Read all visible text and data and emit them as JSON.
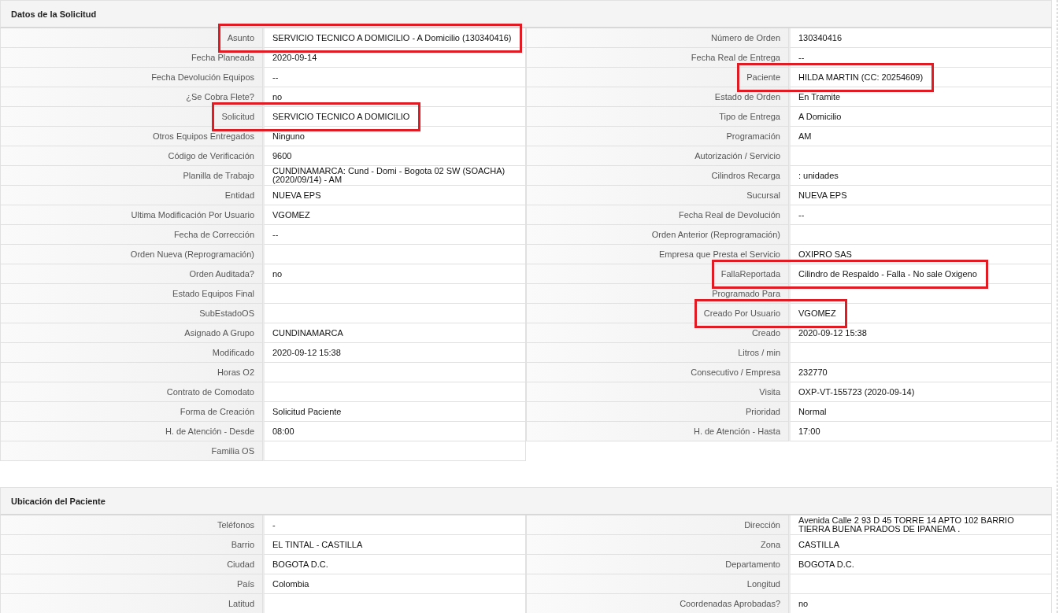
{
  "sections": [
    {
      "title": "Datos de la Solicitud",
      "left": [
        {
          "label": "Asunto",
          "value": "SERVICIO TECNICO A DOMICILIO - A Domicilio (130340416)",
          "highlighted": true
        },
        {
          "label": "Fecha Planeada",
          "value": "2020-09-14",
          "highlighted": false
        },
        {
          "label": "Fecha Devolución Equipos",
          "value": "--",
          "highlighted": false
        },
        {
          "label": "¿Se Cobra Flete?",
          "value": "no",
          "highlighted": false
        },
        {
          "label": "Solicitud",
          "value": "SERVICIO TECNICO A DOMICILIO",
          "highlighted": true
        },
        {
          "label": "Otros Equipos Entregados",
          "value": "Ninguno",
          "highlighted": false
        },
        {
          "label": "Código de Verificación",
          "value": "9600",
          "highlighted": false
        },
        {
          "label": "Planilla de Trabajo",
          "value": "CUNDINAMARCA: Cund - Domi - Bogota 02 SW (SOACHA) (2020/09/14) - AM",
          "highlighted": false
        },
        {
          "label": "Entidad",
          "value": "NUEVA EPS",
          "highlighted": false
        },
        {
          "label": "Ultima Modificación Por Usuario",
          "value": "VGOMEZ",
          "highlighted": false
        },
        {
          "label": "Fecha de Corrección",
          "value": "--",
          "highlighted": false
        },
        {
          "label": "Orden Nueva (Reprogramación)",
          "highlighted": false
        },
        {
          "label": "Orden Auditada?",
          "value": "no",
          "highlighted": false
        },
        {
          "label": "Estado Equipos Final",
          "highlighted": false
        },
        {
          "label": "SubEstadoOS",
          "highlighted": false
        },
        {
          "label": "Asignado A Grupo",
          "value": "CUNDINAMARCA",
          "highlighted": false
        },
        {
          "label": "Modificado",
          "value": "2020-09-12 15:38",
          "highlighted": false
        },
        {
          "label": "Horas O2",
          "highlighted": false
        },
        {
          "label": "Contrato de Comodato",
          "highlighted": false
        },
        {
          "label": "Forma de Creación",
          "value": "Solicitud Paciente",
          "highlighted": false
        },
        {
          "label": "H. de Atención - Desde",
          "value": "08:00",
          "highlighted": false
        },
        {
          "label": "Familia OS",
          "highlighted": false
        }
      ],
      "right": [
        {
          "label": "Número de Orden",
          "value": "130340416",
          "highlighted": false
        },
        {
          "label": "Fecha Real de Entrega",
          "value": "--",
          "highlighted": false
        },
        {
          "label": "Paciente",
          "value": "HILDA MARTIN (CC: 20254609)",
          "highlighted": true
        },
        {
          "label": "Estado de Orden",
          "value": "En Tramite",
          "highlighted": false
        },
        {
          "label": "Tipo de Entrega",
          "value": "A Domicilio",
          "highlighted": false
        },
        {
          "label": "Programación",
          "value": "AM",
          "highlighted": false
        },
        {
          "label": "Autorización / Servicio",
          "highlighted": false
        },
        {
          "label": "Cilindros Recarga",
          "value": ": unidades",
          "highlighted": false
        },
        {
          "label": "Sucursal",
          "value": "NUEVA EPS",
          "highlighted": false
        },
        {
          "label": "Fecha Real de Devolución",
          "value": "--",
          "highlighted": false
        },
        {
          "label": "Orden Anterior (Reprogramación)",
          "highlighted": false
        },
        {
          "label": "Empresa que Presta el Servicio",
          "value": "OXIPRO SAS",
          "highlighted": false
        },
        {
          "label": "FallaReportada",
          "value": "Cilindro de Respaldo - Falla - No sale Oxigeno",
          "highlighted": true
        },
        {
          "label": "Programado Para",
          "highlighted": false
        },
        {
          "label": "Creado Por Usuario",
          "value": "VGOMEZ",
          "highlighted": true
        },
        {
          "label": "Creado",
          "value": "2020-09-12 15:38",
          "highlighted": false
        },
        {
          "label": "Litros / min",
          "highlighted": false
        },
        {
          "label": "Consecutivo / Empresa",
          "value": "232770",
          "highlighted": false
        },
        {
          "label": "Visita",
          "value": "OXP-VT-155723 (2020-09-14)",
          "highlighted": false
        },
        {
          "label": "Prioridad",
          "value": "Normal",
          "highlighted": false
        },
        {
          "label": "H. de Atención - Hasta",
          "value": "17:00",
          "highlighted": false
        }
      ]
    },
    {
      "title": "Ubicación del Paciente",
      "left": [
        {
          "label": "Teléfonos",
          "value": "-",
          "highlighted": false
        },
        {
          "label": "Barrio",
          "value": "EL TINTAL - CASTILLA",
          "highlighted": false
        },
        {
          "label": "Ciudad",
          "value": "BOGOTA D.C.",
          "highlighted": false
        },
        {
          "label": "País",
          "value": "Colombia",
          "highlighted": false
        },
        {
          "label": "Latitud",
          "highlighted": false
        }
      ],
      "right": [
        {
          "label": "Dirección",
          "value": "Avenida Calle 2 93 D 45 TORRE 14 APTO 102 BARRIO TIERRA BUENA PRADOS DE IPANEMA .",
          "highlighted": false
        },
        {
          "label": "Zona",
          "value": "CASTILLA",
          "highlighted": false
        },
        {
          "label": "Departamento",
          "value": "BOGOTA D.C.",
          "highlighted": false
        },
        {
          "label": "Longitud",
          "highlighted": false
        },
        {
          "label": "Coordenadas Aprobadas?",
          "value": "no",
          "highlighted": false
        }
      ]
    }
  ]
}
